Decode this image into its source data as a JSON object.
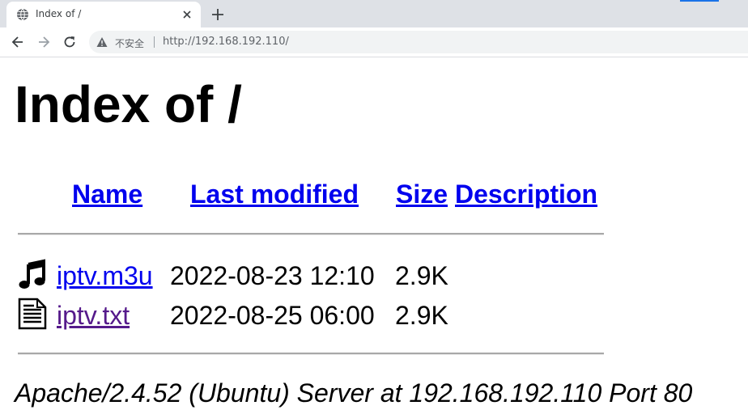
{
  "browser": {
    "tab_title": "Index of /",
    "insecure_label": "不安全",
    "url": "http://192.168.192.110/",
    "accent_color": "#1a73e8",
    "icons": [
      "globe-icon",
      "close-icon",
      "plus-icon",
      "back-arrow-icon",
      "forward-arrow-icon",
      "reload-icon",
      "warning-icon"
    ]
  },
  "page": {
    "heading": "Index of /",
    "columns": [
      "Name",
      "Last modified",
      "Size",
      "Description"
    ],
    "files": [
      {
        "icon": "music-note-icon",
        "name": "iptv.m3u",
        "modified": "2022-08-23 12:10",
        "size": "2.9K",
        "description": "",
        "visited": false
      },
      {
        "icon": "text-document-icon",
        "name": "iptv.txt",
        "modified": "2022-08-25 06:00",
        "size": "2.9K",
        "description": "",
        "visited": true
      }
    ],
    "footer": "Apache/2.4.52 (Ubuntu) Server at 192.168.192.110 Port 80",
    "link_color": "#0000ee",
    "visited_color": "#551a8b"
  }
}
